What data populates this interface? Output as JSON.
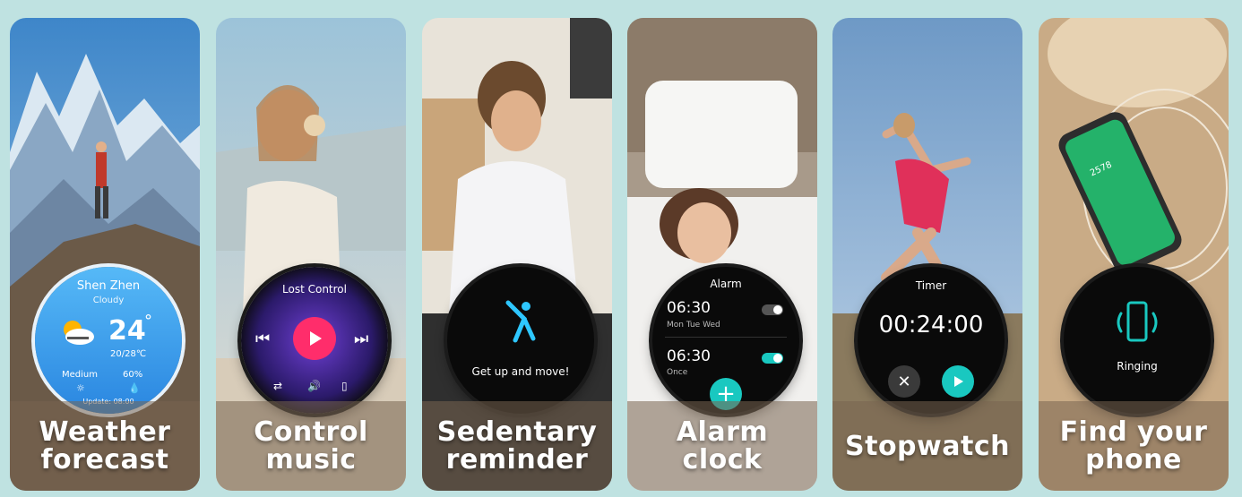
{
  "cards": [
    {
      "caption": [
        "Weather",
        "forecast"
      ],
      "watch": {
        "city": "Shen Zhen",
        "condition": "Cloudy",
        "temp": "24",
        "temp_unit": "°",
        "range": "20/28℃",
        "uv_label": "Medium",
        "humidity": "60%",
        "update": "Update: 08:00"
      }
    },
    {
      "caption": [
        "Control",
        "music"
      ],
      "watch": {
        "track": "Lost Control"
      }
    },
    {
      "caption": [
        "Sedentary",
        "reminder"
      ],
      "watch": {
        "message": "Get up and move!"
      }
    },
    {
      "caption": [
        "Alarm",
        "clock"
      ],
      "watch": {
        "title": "Alarm",
        "alarms": [
          {
            "time": "06:30",
            "days": "Mon Tue Wed",
            "enabled": false
          },
          {
            "time": "06:30",
            "days": "Once",
            "enabled": true
          }
        ]
      }
    },
    {
      "caption": [
        "Stopwatch"
      ],
      "watch": {
        "title": "Timer",
        "time": "00:24:00"
      }
    },
    {
      "caption": [
        "Find your",
        "phone"
      ],
      "watch": {
        "status": "Ringing",
        "phone_steps": "2578"
      }
    }
  ],
  "colors": {
    "background": "#bfe2e1",
    "watch_face": "#0a0a0a",
    "accent_teal": "#19c8c0",
    "accent_pink": "#ff2d6b",
    "weather_blue": "#3aa5f0"
  }
}
